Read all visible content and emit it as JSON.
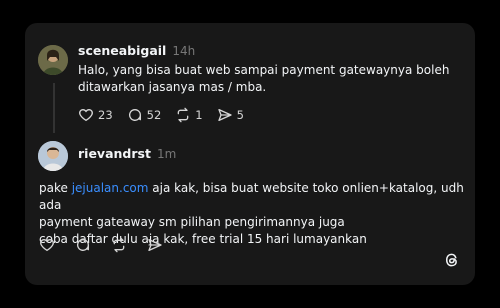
{
  "post": {
    "username": "sceneabigail",
    "time": "14h",
    "text_line1": "Halo, yang bisa buat web sampai payment gatewaynya boleh",
    "text_line2": "ditawarkan jasanya mas / mba.",
    "likes": "23",
    "replies": "52",
    "reposts": "1",
    "shares": "5"
  },
  "reply": {
    "username": "rievandrst",
    "time": "1m",
    "prefix": "pake ",
    "link": "jejualan.com",
    "line1_rest": " aja kak, bisa buat website toko onlien+katalog, udh ada",
    "line2": "payment gateaway sm pilihan pengirimannya juga",
    "line3": "coba daftar dulu aja kak, free trial 15 hari lumayankan"
  },
  "colors": {
    "background": "#000000",
    "card": "#181818",
    "link": "#3a8eff"
  }
}
